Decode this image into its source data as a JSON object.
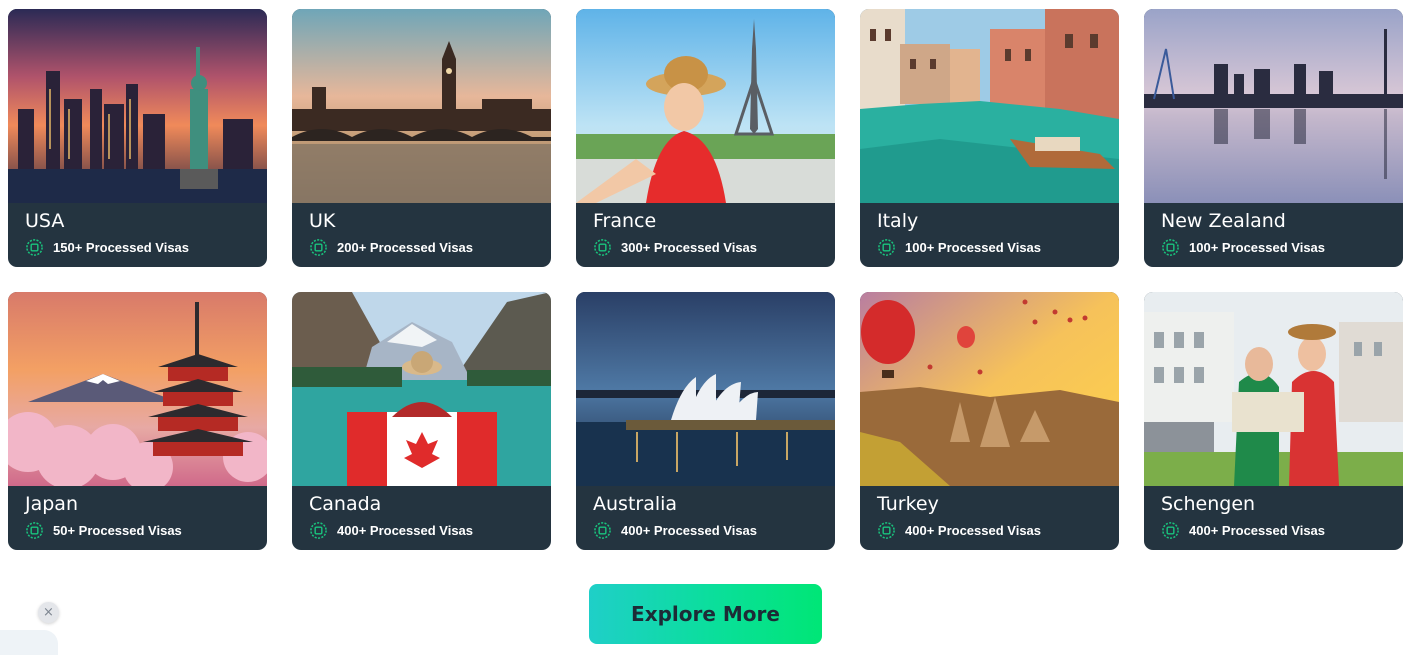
{
  "destinations": [
    {
      "name": "USA",
      "visas": "150+ Processed Visas"
    },
    {
      "name": "UK",
      "visas": "200+ Processed Visas"
    },
    {
      "name": "France",
      "visas": "300+ Processed Visas"
    },
    {
      "name": "Italy",
      "visas": "100+ Processed Visas"
    },
    {
      "name": "New Zealand",
      "visas": "100+ Processed Visas"
    },
    {
      "name": "Japan",
      "visas": "50+ Processed Visas"
    },
    {
      "name": "Canada",
      "visas": "400+ Processed Visas"
    },
    {
      "name": "Australia",
      "visas": "400+ Processed Visas"
    },
    {
      "name": "Turkey",
      "visas": "400+ Processed Visas"
    },
    {
      "name": "Schengen",
      "visas": "400+ Processed Visas"
    }
  ],
  "explore_label": "Explore More",
  "close_symbol": "×",
  "colors": {
    "card_bg": "#243440",
    "accent_green": "#19c37d",
    "button_start": "#1fcfc8",
    "button_end": "#00e676"
  },
  "icons": {
    "visa": "visa-stamp-icon",
    "close": "close-icon"
  }
}
